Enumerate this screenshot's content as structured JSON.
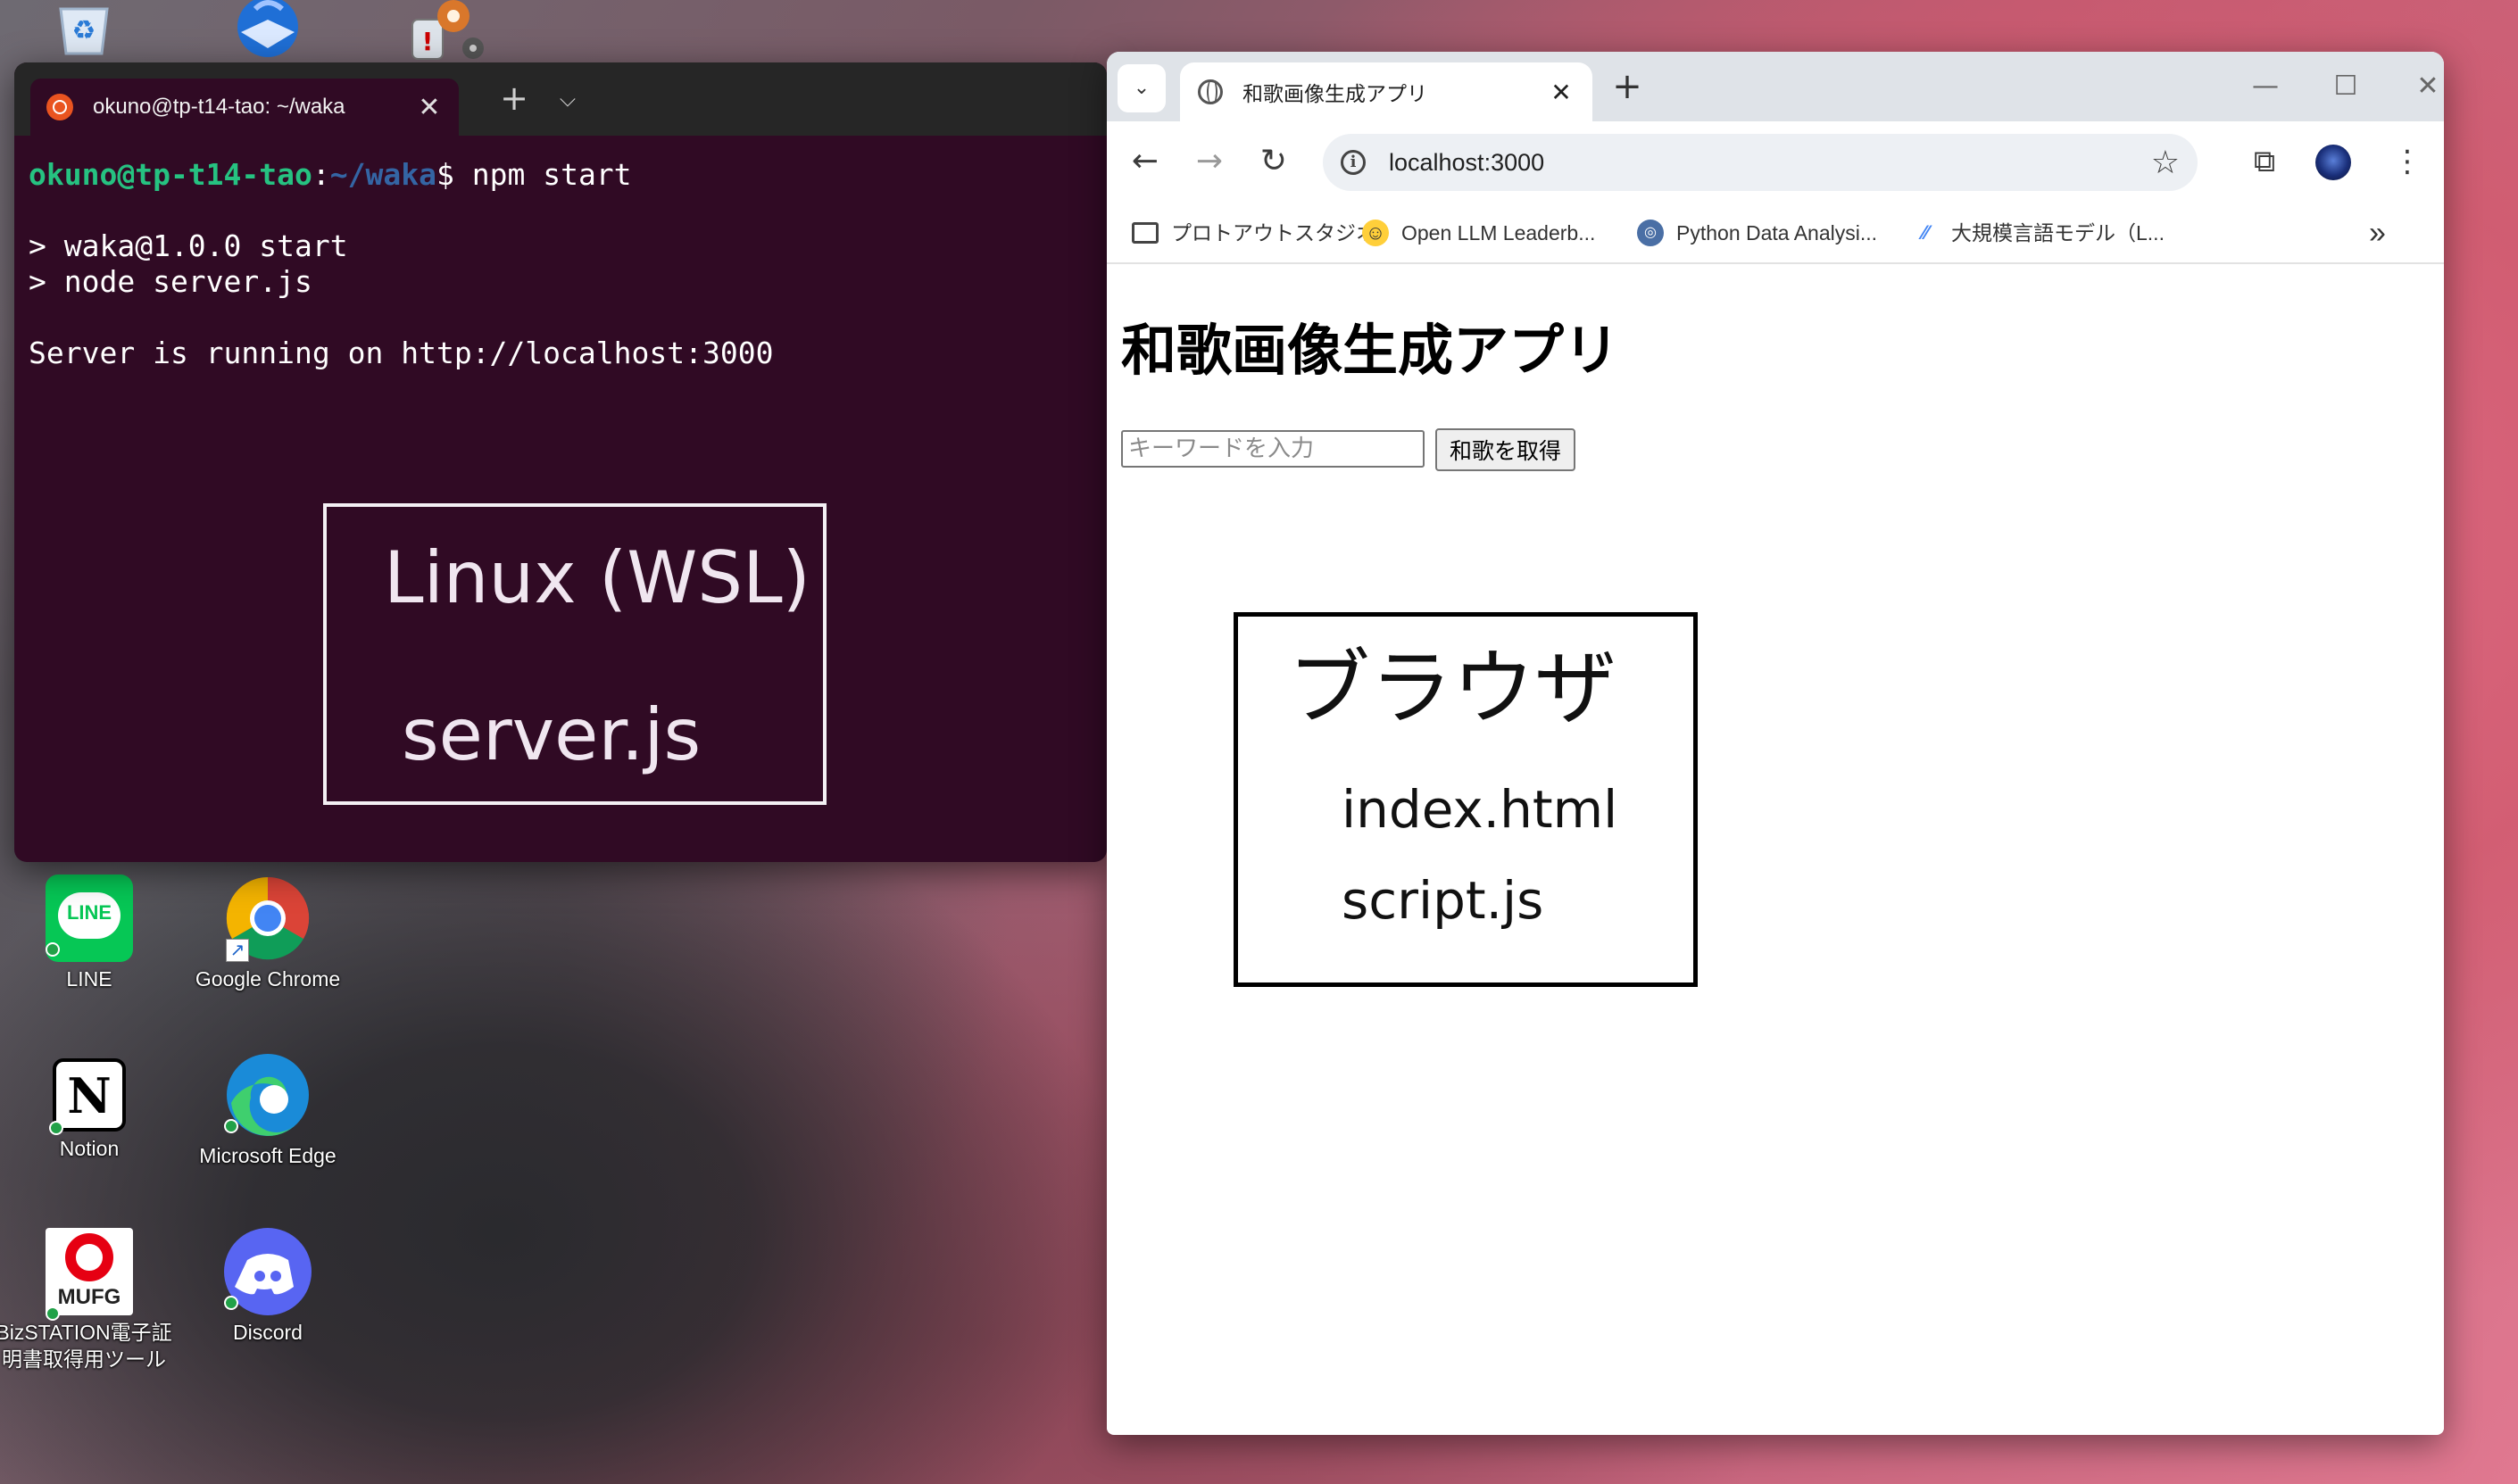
{
  "desktop": {
    "icons": [
      {
        "label": "LINE"
      },
      {
        "label": "Google Chrome"
      },
      {
        "label": "Notion"
      },
      {
        "label": "Microsoft Edge"
      },
      {
        "label": "BizSTATION電子証明書取得用ツール"
      },
      {
        "label": "Discord"
      }
    ],
    "line_tile_text": "LINE",
    "mufg_tile_text": "MUFG",
    "notion_tile_text": "N"
  },
  "terminal": {
    "tab_title": "okuno@tp-t14-tao: ~/waka",
    "prompt_user": "okuno@tp-t14-tao",
    "prompt_sep": ":",
    "prompt_path": "~/waka",
    "prompt_symbol": "$ ",
    "command": "npm start",
    "output": [
      "",
      "> waka@1.0.0 start",
      "> node server.js",
      "",
      "Server is running on http://localhost:3000"
    ],
    "annotation_title": "Linux (WSL)",
    "annotation_file": "server.js"
  },
  "browser": {
    "tab_title": "和歌画像生成アプリ",
    "url": "localhost:3000",
    "bookmarks": [
      {
        "label": "プロトアウトスタジオ",
        "icon": "folder-icon"
      },
      {
        "label": "Open LLM Leaderb...",
        "icon": "huggingface-icon"
      },
      {
        "label": "Python Data Analysi...",
        "icon": "python-icon"
      },
      {
        "label": "大規模言語モデル（L...",
        "icon": "ai-icon"
      }
    ],
    "more_bookmarks": "»",
    "page": {
      "heading": "和歌画像生成アプリ",
      "input_placeholder": "キーワードを入力",
      "button_label": "和歌を取得",
      "annotation_title": "ブラウザ",
      "annotation_file1": "index.html",
      "annotation_file2": "script.js"
    }
  },
  "colors": {
    "terminal_bg": "#300a24",
    "prompt_user": "#26c281",
    "prompt_path": "#3465a4",
    "ubuntu_orange": "#e95420"
  }
}
